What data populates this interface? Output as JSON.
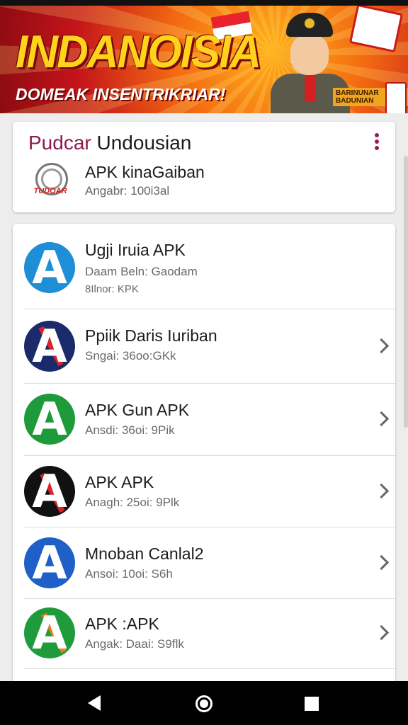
{
  "banner": {
    "title": "INDANOISIA",
    "subtitle": "DOMEAK INSENTRIKRIAR!",
    "badge": "BARINUNAR BADUNIAN"
  },
  "featured": {
    "title_part1": "Pudcar",
    "title_part2": "Undousian",
    "app_name": "APK kinaGaiban",
    "app_meta": "Angabr: 100i3al",
    "logo_text": "TUDOAR"
  },
  "apps": [
    {
      "name": "Ugji Iruia APK",
      "sub1": "Daam Beln: Gaodam",
      "sub2": "8Ilnor: KPK",
      "color": "#1e8fd6",
      "letter": "A",
      "chevron": false
    },
    {
      "name": "Ppiik Daris Iuriban",
      "sub1": "Sngai: 36oo:GKk",
      "sub2": "",
      "color": "#1b2a6b",
      "letter": "A",
      "chevron": true
    },
    {
      "name": "APK Gun APK",
      "sub1": "Ansdi: 36oi: 9Pik",
      "sub2": "",
      "color": "#1d9a3a",
      "letter": "A",
      "chevron": true
    },
    {
      "name": "APK APK",
      "sub1": "Anagh: 25oi: 9Plk",
      "sub2": "",
      "color": "#111111",
      "letter": "A",
      "chevron": true
    },
    {
      "name": "Mnoban Canlal2",
      "sub1": "Ansoi: 10oi: S6h",
      "sub2": "",
      "color": "#1e5fc8",
      "letter": "A",
      "chevron": true
    },
    {
      "name": "APK :APK",
      "sub1": "Angak: Daai: S9flk",
      "sub2": "",
      "color": "#1f9b3c",
      "letter": "A",
      "chevron": true
    }
  ]
}
